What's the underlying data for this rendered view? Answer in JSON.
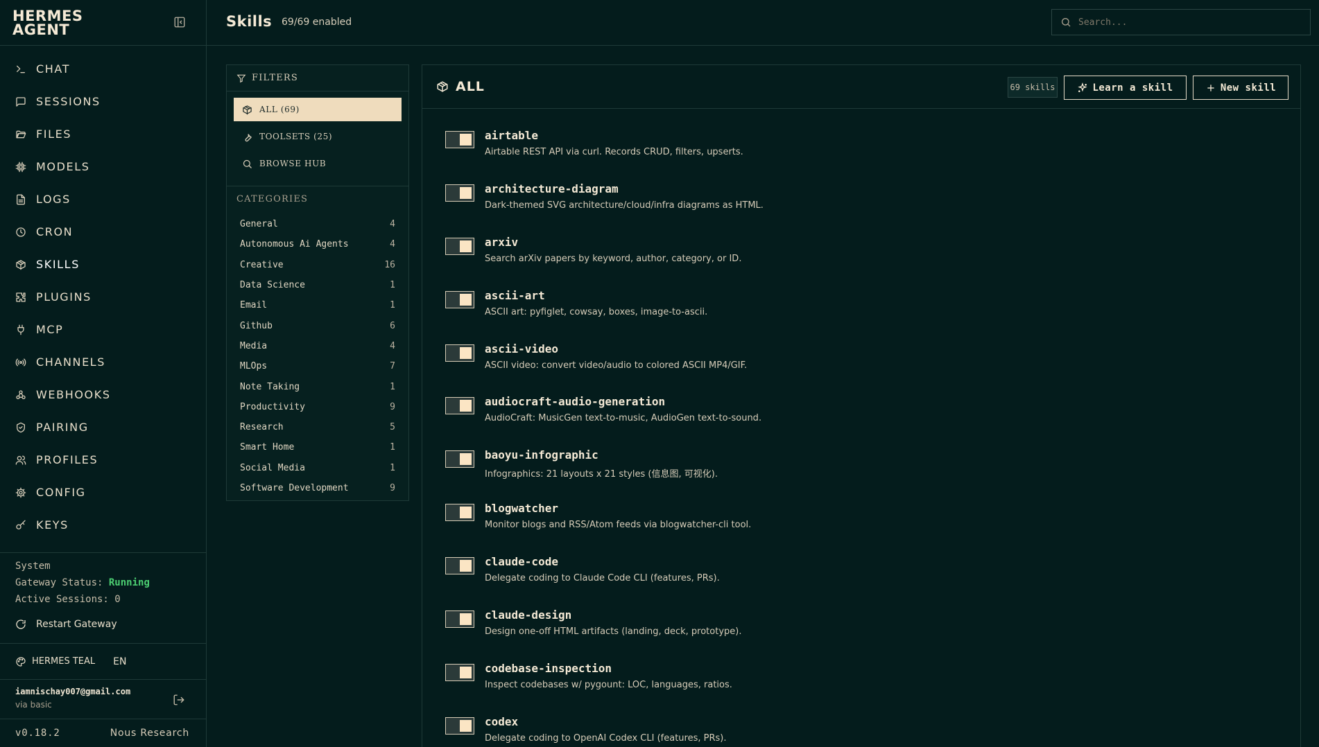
{
  "brand": {
    "line1": "HERMES",
    "line2": "AGENT"
  },
  "nav": [
    {
      "label": "CHAT",
      "icon": "terminal-icon"
    },
    {
      "label": "SESSIONS",
      "icon": "message-square-icon"
    },
    {
      "label": "FILES",
      "icon": "folder-open-icon"
    },
    {
      "label": "MODELS",
      "icon": "cpu-icon"
    },
    {
      "label": "LOGS",
      "icon": "file-text-icon"
    },
    {
      "label": "CRON",
      "icon": "clock-icon"
    },
    {
      "label": "SKILLS",
      "icon": "package-icon",
      "active": true
    },
    {
      "label": "PLUGINS",
      "icon": "puzzle-icon"
    },
    {
      "label": "MCP",
      "icon": "plug-icon"
    },
    {
      "label": "CHANNELS",
      "icon": "radio-icon"
    },
    {
      "label": "WEBHOOKS",
      "icon": "webhook-icon"
    },
    {
      "label": "PAIRING",
      "icon": "shield-check-icon"
    },
    {
      "label": "PROFILES",
      "icon": "users-icon"
    },
    {
      "label": "CONFIG",
      "icon": "gear-icon"
    },
    {
      "label": "KEYS",
      "icon": "key-icon"
    }
  ],
  "system": {
    "title": "System",
    "gateway_label": "Gateway Status:",
    "gateway_value": "Running",
    "sessions_label": "Active Sessions:",
    "sessions_value": "0",
    "restart_label": "Restart Gateway"
  },
  "theme": {
    "name": "HERMES TEAL",
    "lang": "EN"
  },
  "user": {
    "email": "iamnischay007@gmail.com",
    "via": "via basic"
  },
  "footer": {
    "version": "v0.18.2",
    "org": "Nous Research"
  },
  "header": {
    "title": "Skills",
    "count": "69/69 enabled"
  },
  "search": {
    "placeholder": "Search..."
  },
  "filters": {
    "title": "FILTERS",
    "items": [
      {
        "label": "ALL (69)",
        "icon": "package-icon",
        "active": true
      },
      {
        "label": "TOOLSETS (25)",
        "icon": "wrench-icon"
      },
      {
        "label": "BROWSE HUB",
        "icon": "search-icon"
      }
    ],
    "categories_title": "CATEGORIES",
    "categories": [
      {
        "name": "General",
        "count": "4"
      },
      {
        "name": "Autonomous Ai Agents",
        "count": "4"
      },
      {
        "name": "Creative",
        "count": "16"
      },
      {
        "name": "Data Science",
        "count": "1"
      },
      {
        "name": "Email",
        "count": "1"
      },
      {
        "name": "Github",
        "count": "6"
      },
      {
        "name": "Media",
        "count": "4"
      },
      {
        "name": "MLOps",
        "count": "7"
      },
      {
        "name": "Note Taking",
        "count": "1"
      },
      {
        "name": "Productivity",
        "count": "9"
      },
      {
        "name": "Research",
        "count": "5"
      },
      {
        "name": "Smart Home",
        "count": "1"
      },
      {
        "name": "Social Media",
        "count": "1"
      },
      {
        "name": "Software Development",
        "count": "9"
      }
    ]
  },
  "main": {
    "title": "ALL",
    "badge": "69 skills",
    "learn_label": "Learn a skill",
    "new_label": "New skill"
  },
  "skills": [
    {
      "name": "airtable",
      "desc": "Airtable REST API via curl. Records CRUD, filters, upserts.",
      "enabled": true
    },
    {
      "name": "architecture-diagram",
      "desc": "Dark-themed SVG architecture/cloud/infra diagrams as HTML.",
      "enabled": true
    },
    {
      "name": "arxiv",
      "desc": "Search arXiv papers by keyword, author, category, or ID.",
      "enabled": true
    },
    {
      "name": "ascii-art",
      "desc": "ASCII art: pyfiglet, cowsay, boxes, image-to-ascii.",
      "enabled": true
    },
    {
      "name": "ascii-video",
      "desc": "ASCII video: convert video/audio to colored ASCII MP4/GIF.",
      "enabled": true
    },
    {
      "name": "audiocraft-audio-generation",
      "desc": "AudioCraft: MusicGen text-to-music, AudioGen text-to-sound.",
      "enabled": true
    },
    {
      "name": "baoyu-infographic",
      "desc": "Infographics: 21 layouts x 21 styles (信息图, 可视化).",
      "enabled": true
    },
    {
      "name": "blogwatcher",
      "desc": "Monitor blogs and RSS/Atom feeds via blogwatcher-cli tool.",
      "enabled": true
    },
    {
      "name": "claude-code",
      "desc": "Delegate coding to Claude Code CLI (features, PRs).",
      "enabled": true
    },
    {
      "name": "claude-design",
      "desc": "Design one-off HTML artifacts (landing, deck, prototype).",
      "enabled": true
    },
    {
      "name": "codebase-inspection",
      "desc": "Inspect codebases w/ pygount: LOC, languages, ratios.",
      "enabled": true
    },
    {
      "name": "codex",
      "desc": "Delegate coding to OpenAI Codex CLI (features, PRs).",
      "enabled": true
    }
  ],
  "colors": {
    "background": "#041c1c",
    "accent": "#efdcbd",
    "status_ok": "#4ccf72",
    "border": "#1f3a38"
  }
}
